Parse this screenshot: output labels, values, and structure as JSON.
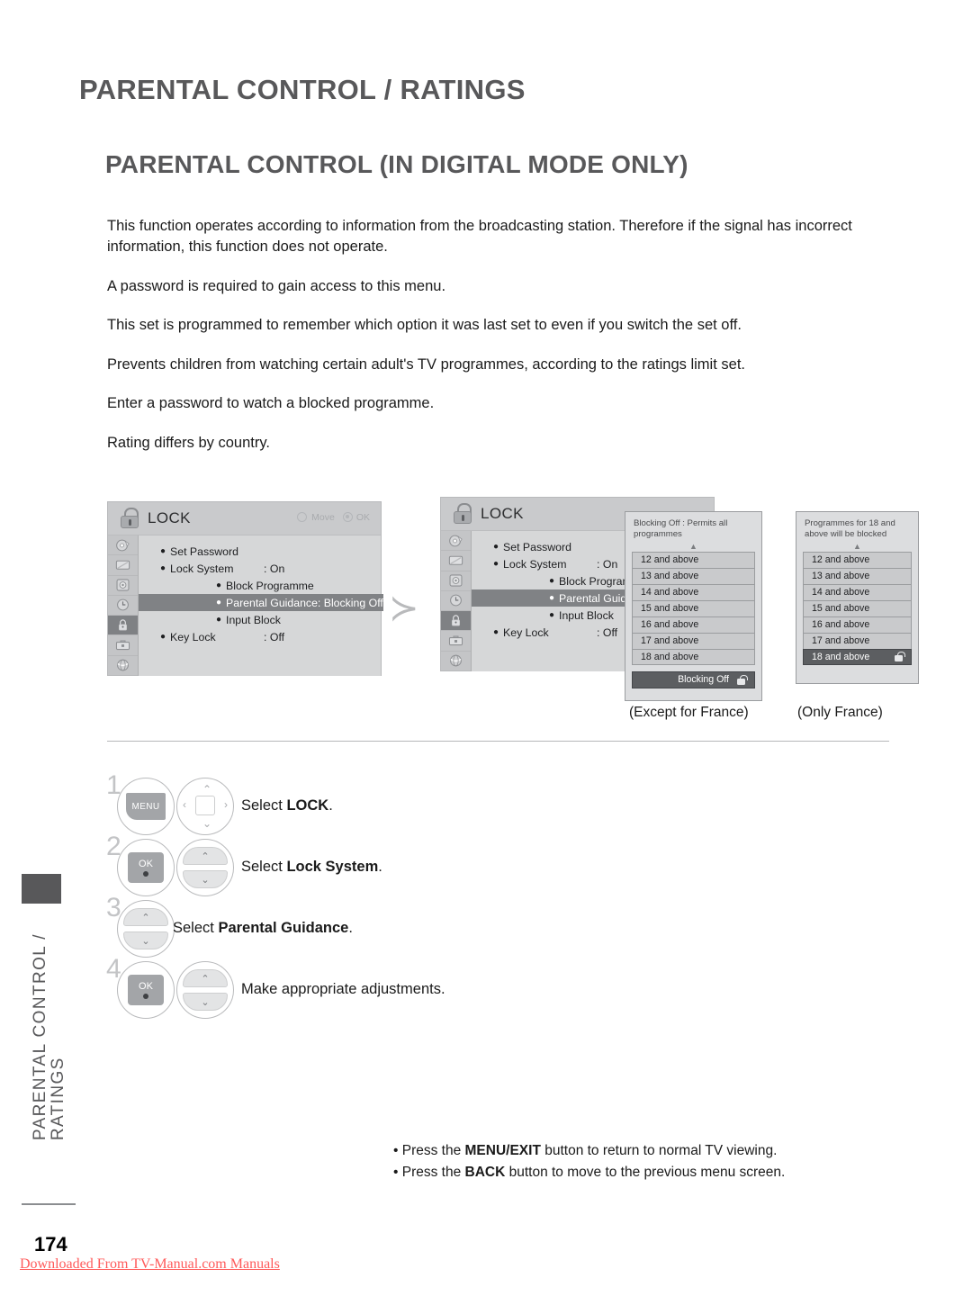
{
  "chapter_title": "PARENTAL CONTROL / RATINGS",
  "section_title": "PARENTAL CONTROL (IN DIGITAL MODE ONLY)",
  "intro_paragraphs": [
    "This function operates according to information from the broadcasting station. Therefore if the signal has incorrect information, this function does not operate.",
    "A password is required to gain access to this menu.",
    "This set is programmed to remember which option it was last set to even if you switch the set off.",
    "Prevents children from watching certain adult's TV programmes, according to the ratings limit set.",
    "Enter a password to watch a blocked programme.",
    "Rating differs by country."
  ],
  "osd": {
    "title": "LOCK",
    "hints": {
      "move": "Move",
      "ok": "OK"
    },
    "rail_icons": [
      "setup-disc-icon",
      "picture-tv-icon",
      "audio-speaker-icon",
      "time-clock-icon",
      "lock-icon",
      "option-toolbox-icon",
      "network-globe-icon"
    ],
    "menu_rows": [
      {
        "label": "Set Password",
        "value": ""
      },
      {
        "label": "Lock System",
        "value": ": On"
      },
      {
        "label": "Block Programme",
        "value": ""
      },
      {
        "label": "Parental Guidance: Blocking Off",
        "value": ""
      },
      {
        "label": "Input Block",
        "value": ""
      },
      {
        "label": "Key Lock",
        "value": ": Off"
      }
    ],
    "menu_rows_truncated": [
      {
        "label": "Set Password",
        "value": ""
      },
      {
        "label": "Lock System",
        "value": ": On"
      },
      {
        "label": "Block Program",
        "value": ""
      },
      {
        "label": "Parental Guida",
        "value": ""
      },
      {
        "label": "Input Block",
        "value": ""
      },
      {
        "label": "Key Lock",
        "value": ": Off"
      }
    ]
  },
  "rating_panel_left": {
    "note": "Blocking Off : Permits all programmes",
    "up_arrow": "▲",
    "items": [
      "12 and above",
      "13 and above",
      "14 and above",
      "15 and above",
      "16 and above",
      "17 and above",
      "18 and above"
    ],
    "footer_label": "Blocking Off",
    "caption": "(Except for France)"
  },
  "rating_panel_right": {
    "note": "Programmes for 18 and above will be blocked",
    "up_arrow": "▲",
    "items": [
      "12 and above",
      "13 and above",
      "14 and above",
      "15 and above",
      "16 and above",
      "17 and above",
      "18 and above"
    ],
    "selected_item": "18 and above",
    "caption": "(Only France)"
  },
  "arrow_glyph": "≻",
  "steps": [
    {
      "number": "1",
      "button_primary": "MENU",
      "button_secondary": "dpad",
      "text_prefix": "Select ",
      "text_bold": "LOCK",
      "text_suffix": "."
    },
    {
      "number": "2",
      "button_primary": "OK",
      "button_secondary": "rocker",
      "text_prefix": "Select ",
      "text_bold": "Lock System",
      "text_suffix": "."
    },
    {
      "number": "3",
      "button_primary": "rocker",
      "button_secondary": "",
      "text_prefix": "Select ",
      "text_bold": "Parental Guidance",
      "text_suffix": "."
    },
    {
      "number": "4",
      "button_primary": "OK",
      "button_secondary": "rocker",
      "text_prefix": "",
      "text_bold": "",
      "text_suffix": "Make appropriate adjustments."
    }
  ],
  "notes": [
    {
      "prefix": "• Press the ",
      "bold": "MENU/EXIT",
      "suffix": " button to return to normal TV viewing."
    },
    {
      "prefix": "• Press the ",
      "bold": "BACK",
      "suffix": " button to move to the previous menu screen."
    }
  ],
  "side_tab": "PARENTAL CONTROL /\nRATINGS",
  "side_tab_line1": "PARENTAL CONTROL /",
  "side_tab_line2": "RATINGS",
  "page_number": "174",
  "watermark": "Downloaded From TV-Manual.com Manuals",
  "colors": {
    "heading": "#58585a",
    "osd_bg": "#d6d7d8",
    "osd_highlight": "#808285",
    "watermark": "#ff5a5a"
  }
}
